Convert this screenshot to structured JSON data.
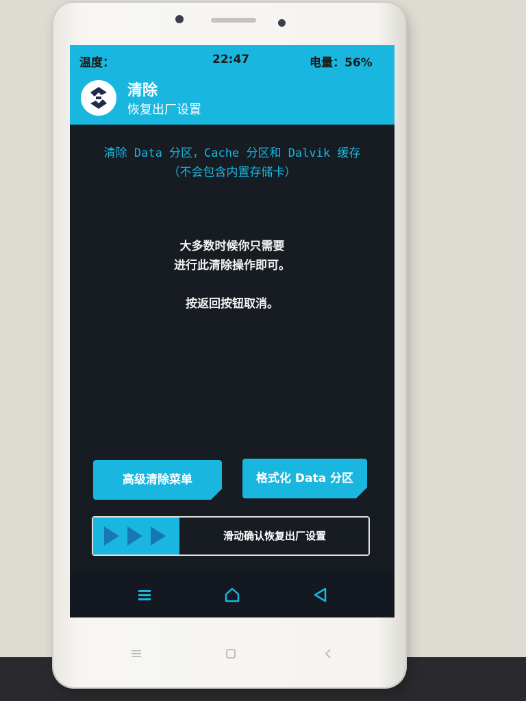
{
  "status_bar": {
    "temperature_label": "温度：",
    "time": "22:47",
    "battery": "电量：56%"
  },
  "header": {
    "title": "清除",
    "subtitle": "恢复出厂设置",
    "logo_icon": "twrp-logo-icon"
  },
  "info": {
    "wipe_line1": "清除 Data 分区，Cache 分区和 Dalvik 缓存",
    "wipe_line2": "（不会包含内置存储卡）",
    "hint_line1": "大多数时候你只需要",
    "hint_line2": "进行此清除操作即可。",
    "hint_line3": "按返回按钮取消。"
  },
  "buttons": {
    "advanced_wipe": "高级清除菜单",
    "format_data": "格式化 Data 分区"
  },
  "slider": {
    "label": "滑动确认恢复出厂设置"
  },
  "nav": {
    "menu_icon": "menu-icon",
    "home_icon": "home-icon",
    "back_icon": "back-icon"
  },
  "colors": {
    "accent": "#19b7e0",
    "background": "#171b22",
    "text": "#ffffff"
  }
}
